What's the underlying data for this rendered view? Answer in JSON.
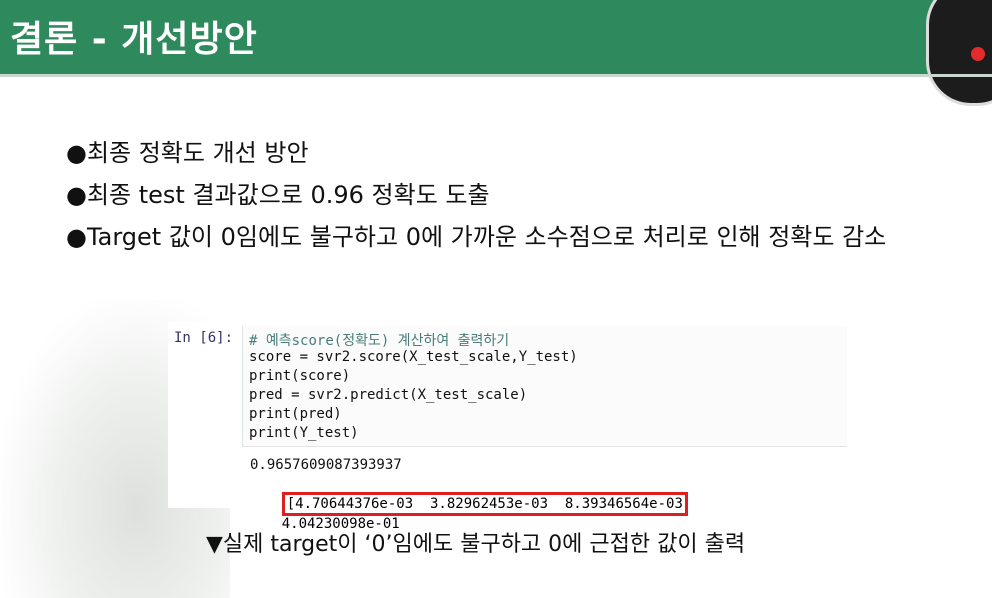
{
  "header": {
    "title": "결론 - 개선방안"
  },
  "bullets": [
    "●최종 정확도 개선 방안",
    "●최종 test 결과값으로 0.96 정확도 도출",
    "●Target 값이 0임에도 불구하고 0에 가까운 소수점으로 처리로 인해 정확도 감소"
  ],
  "code": {
    "prompt": "In [6]:",
    "lines": [
      "# 예측score(정확도) 계산하여 출력하기",
      "score = svr2.score(X_test_scale,Y_test)",
      "print(score)",
      "pred = svr2.predict(X_test_scale)",
      "print(pred)",
      "print(Y_test)"
    ],
    "output_score": "0.9657609087393937",
    "pred_highlighted": "[4.70644376e-03  3.82962453e-03  8.39346564e-03",
    "pred_rest": "4.04230098e-01"
  },
  "caption": "▼실제 target이 ‘0’임에도 불구하고 0에 근접한 값이 출력",
  "colors": {
    "header": "#2e8a5c",
    "highlight_border": "#dd1f1f"
  }
}
